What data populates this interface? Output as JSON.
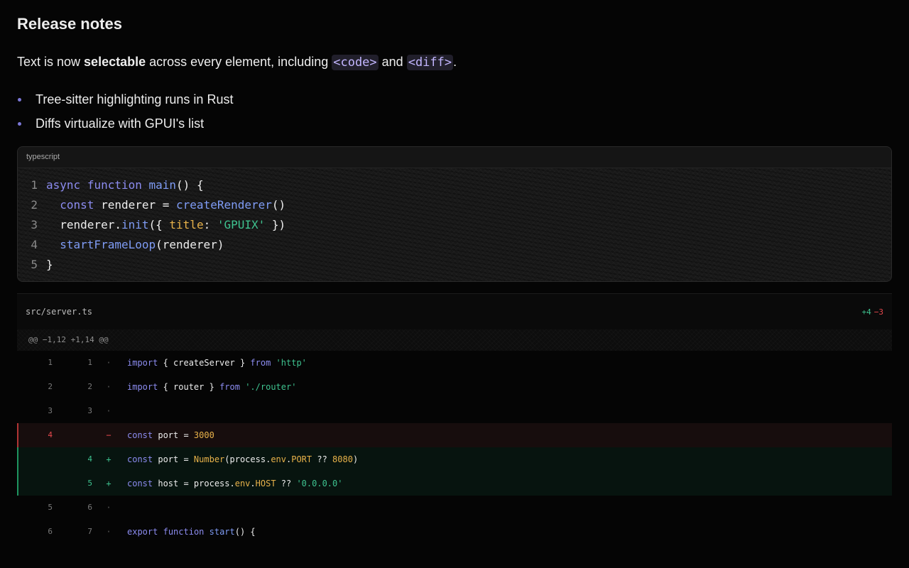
{
  "heading": "Release notes",
  "paragraph": {
    "text_before": "Text is now ",
    "bold": "selectable",
    "text_middle": " across every element, including ",
    "code1": "<code>",
    "text_and": " and ",
    "code2": "<diff>",
    "text_end": "."
  },
  "bullets": [
    "Tree-sitter highlighting runs in Rust",
    "Diffs virtualize with GPUI's list"
  ],
  "codeblock": {
    "language": "typescript",
    "lines": [
      {
        "n": "1",
        "tokens": [
          [
            "kw",
            "async"
          ],
          [
            "id",
            " "
          ],
          [
            "kw",
            "function"
          ],
          [
            "id",
            " "
          ],
          [
            "fn",
            "main"
          ],
          [
            "id",
            "() {"
          ]
        ]
      },
      {
        "n": "2",
        "tokens": [
          [
            "id",
            "  "
          ],
          [
            "kw",
            "const"
          ],
          [
            "id",
            " renderer = "
          ],
          [
            "fn",
            "createRenderer"
          ],
          [
            "id",
            "()"
          ]
        ]
      },
      {
        "n": "3",
        "tokens": [
          [
            "id",
            "  renderer."
          ],
          [
            "fn",
            "init"
          ],
          [
            "id",
            "({ "
          ],
          [
            "pr",
            "title"
          ],
          [
            "id",
            ": "
          ],
          [
            "st",
            "'GPUIX'"
          ],
          [
            "id",
            " })"
          ]
        ]
      },
      {
        "n": "4",
        "tokens": [
          [
            "id",
            "  "
          ],
          [
            "fn",
            "startFrameLoop"
          ],
          [
            "id",
            "(renderer)"
          ]
        ]
      },
      {
        "n": "5",
        "tokens": [
          [
            "id",
            "}"
          ]
        ]
      }
    ]
  },
  "diff": {
    "file": "src/server.ts",
    "additions": "+4",
    "deletions": "−3",
    "hunk": "@@ −1,12 +1,14 @@",
    "rows": [
      {
        "type": "ctx",
        "old": "1",
        "new": "1",
        "mark": "·",
        "tokens": [
          [
            "kw",
            "import"
          ],
          [
            "id",
            " { createServer } "
          ],
          [
            "kw",
            "from"
          ],
          [
            "id",
            " "
          ],
          [
            "st",
            "'http'"
          ]
        ]
      },
      {
        "type": "ctx",
        "old": "2",
        "new": "2",
        "mark": "·",
        "tokens": [
          [
            "kw",
            "import"
          ],
          [
            "id",
            " { router } "
          ],
          [
            "kw",
            "from"
          ],
          [
            "id",
            " "
          ],
          [
            "st",
            "'./router'"
          ]
        ]
      },
      {
        "type": "ctx",
        "old": "3",
        "new": "3",
        "mark": "·",
        "tokens": []
      },
      {
        "type": "del",
        "old": "4",
        "new": "",
        "mark": "−",
        "tokens": [
          [
            "kw",
            "const"
          ],
          [
            "id",
            " port = "
          ],
          [
            "num",
            "3000"
          ]
        ]
      },
      {
        "type": "add",
        "old": "",
        "new": "4",
        "mark": "+",
        "tokens": [
          [
            "kw",
            "const"
          ],
          [
            "id",
            " port = "
          ],
          [
            "pr",
            "Number"
          ],
          [
            "id",
            "(process."
          ],
          [
            "pr",
            "env"
          ],
          [
            "id",
            "."
          ],
          [
            "pr",
            "PORT"
          ],
          [
            "id",
            " ?? "
          ],
          [
            "num",
            "8080"
          ],
          [
            "id",
            ")"
          ]
        ]
      },
      {
        "type": "add",
        "old": "",
        "new": "5",
        "mark": "+",
        "tokens": [
          [
            "kw",
            "const"
          ],
          [
            "id",
            " host = process."
          ],
          [
            "pr",
            "env"
          ],
          [
            "id",
            "."
          ],
          [
            "pr",
            "HOST"
          ],
          [
            "id",
            " ?? "
          ],
          [
            "st",
            "'0.0.0.0'"
          ]
        ]
      },
      {
        "type": "ctx",
        "old": "5",
        "new": "6",
        "mark": "·",
        "tokens": []
      },
      {
        "type": "ctx",
        "old": "6",
        "new": "7",
        "mark": "·",
        "tokens": [
          [
            "kw",
            "export"
          ],
          [
            "id",
            " "
          ],
          [
            "kw",
            "function"
          ],
          [
            "id",
            " "
          ],
          [
            "fn",
            "start"
          ],
          [
            "id",
            "() {"
          ]
        ]
      }
    ]
  },
  "colors": {
    "background": "#050505",
    "keyword": "#8c8cf0",
    "function": "#7f9cf5",
    "property": "#e8b24a",
    "string": "#3ec28f",
    "added": "#3ec28f",
    "deleted": "#e5484d"
  }
}
